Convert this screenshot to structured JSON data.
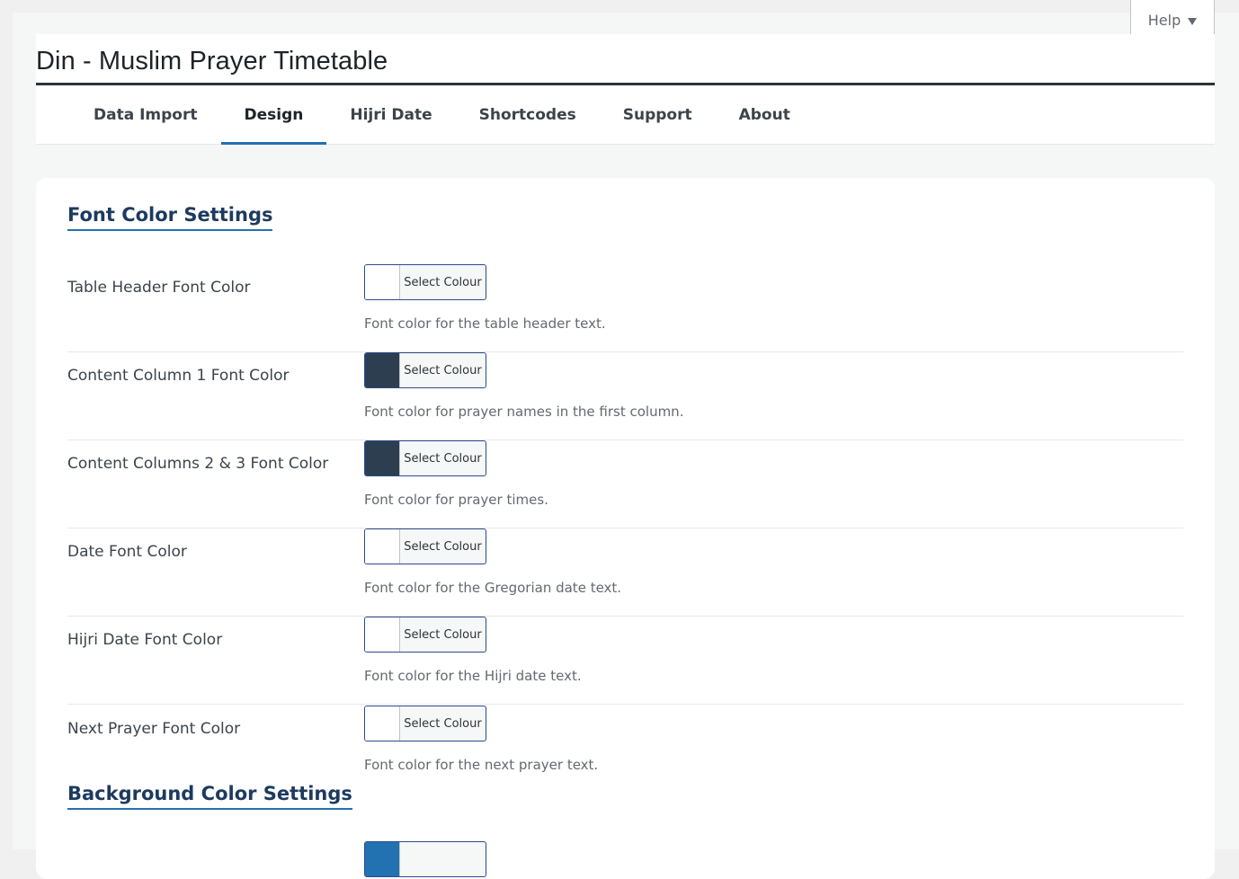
{
  "help": {
    "label": "Help"
  },
  "page_title": "Din - Muslim Prayer Timetable",
  "tabs": [
    {
      "label": "Data Import",
      "active": false
    },
    {
      "label": "Design",
      "active": true
    },
    {
      "label": "Hijri Date",
      "active": false
    },
    {
      "label": "Shortcodes",
      "active": false
    },
    {
      "label": "Support",
      "active": false
    },
    {
      "label": "About",
      "active": false
    }
  ],
  "font_section": {
    "title": "Font Color Settings",
    "rows": [
      {
        "label": "Table Header Font Color",
        "button": "Select Colour",
        "swatch": "#ffffff",
        "desc": "Font color for the table header text."
      },
      {
        "label": "Content Column 1 Font Color",
        "button": "Select Colour",
        "swatch": "#2c3e50",
        "desc": "Font color for prayer names in the first column."
      },
      {
        "label": "Content Columns 2 & 3 Font Color",
        "button": "Select Colour",
        "swatch": "#2c3e50",
        "desc": "Font color for prayer times."
      },
      {
        "label": "Date Font Color",
        "button": "Select Colour",
        "swatch": "#ffffff",
        "desc": "Font color for the Gregorian date text."
      },
      {
        "label": "Hijri Date Font Color",
        "button": "Select Colour",
        "swatch": "#ffffff",
        "desc": "Font color for the Hijri date text."
      },
      {
        "label": "Next Prayer Font Color",
        "button": "Select Colour",
        "swatch": "#ffffff",
        "desc": "Font color for the next prayer text."
      }
    ]
  },
  "bg_section": {
    "title": "Background Color Settings",
    "first_swatch": "#2271b1"
  }
}
